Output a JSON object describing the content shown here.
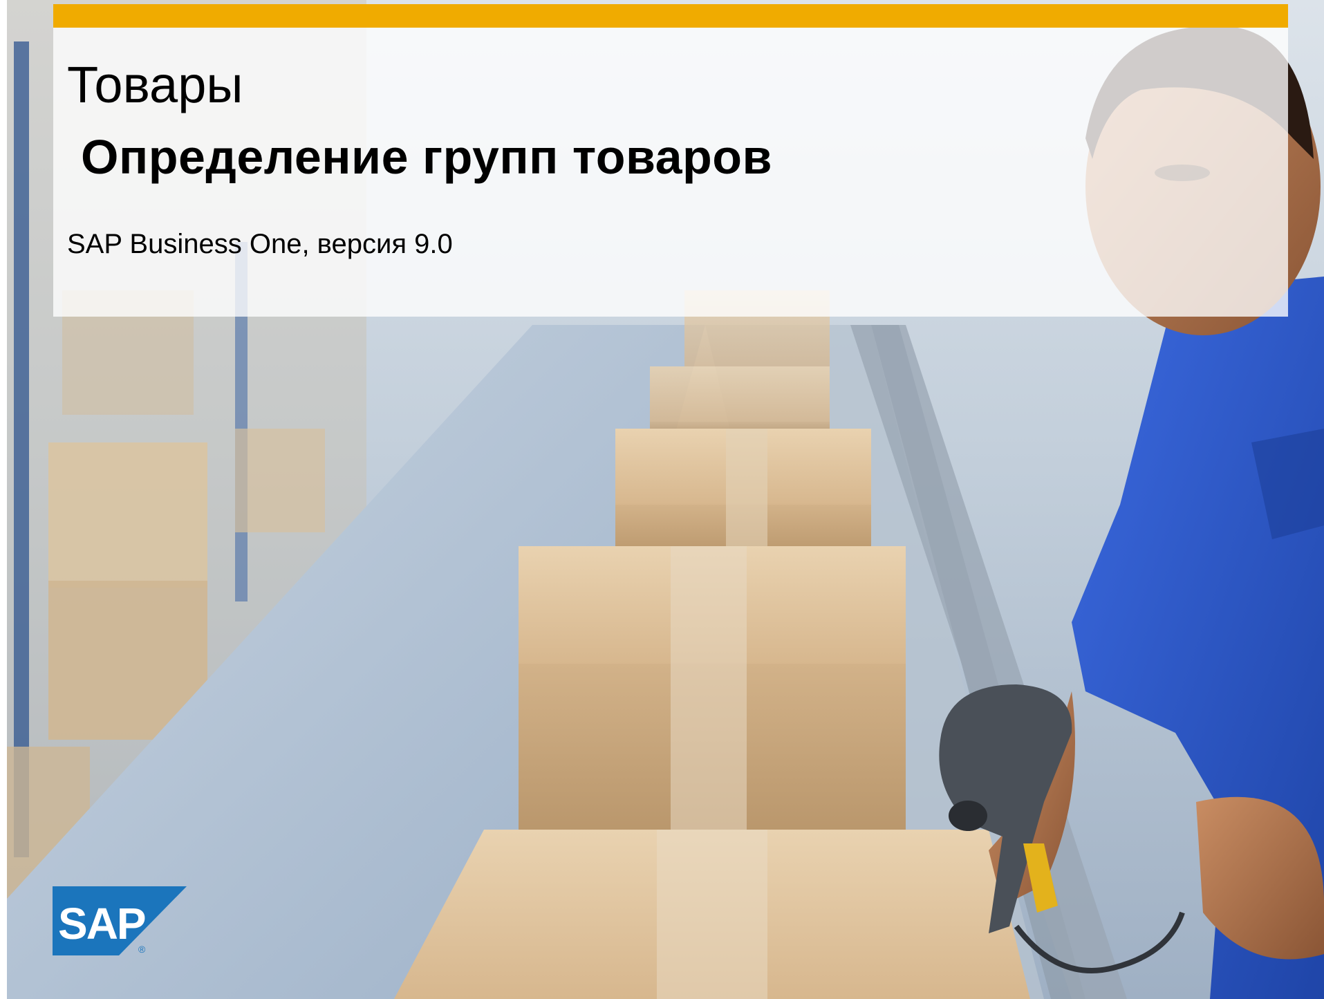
{
  "slide": {
    "title": "Товары",
    "subtitle": "Определение групп товаров",
    "version": "SAP Business One, версия 9.0"
  },
  "logo": {
    "text": "SAP",
    "icon": "sap-logo-icon"
  },
  "colors": {
    "accent_bar": "#f0ab00",
    "logo_blue": "#1b75bc",
    "shirt_blue": "#2a56c6",
    "box_cardboard": "#cfae84"
  }
}
